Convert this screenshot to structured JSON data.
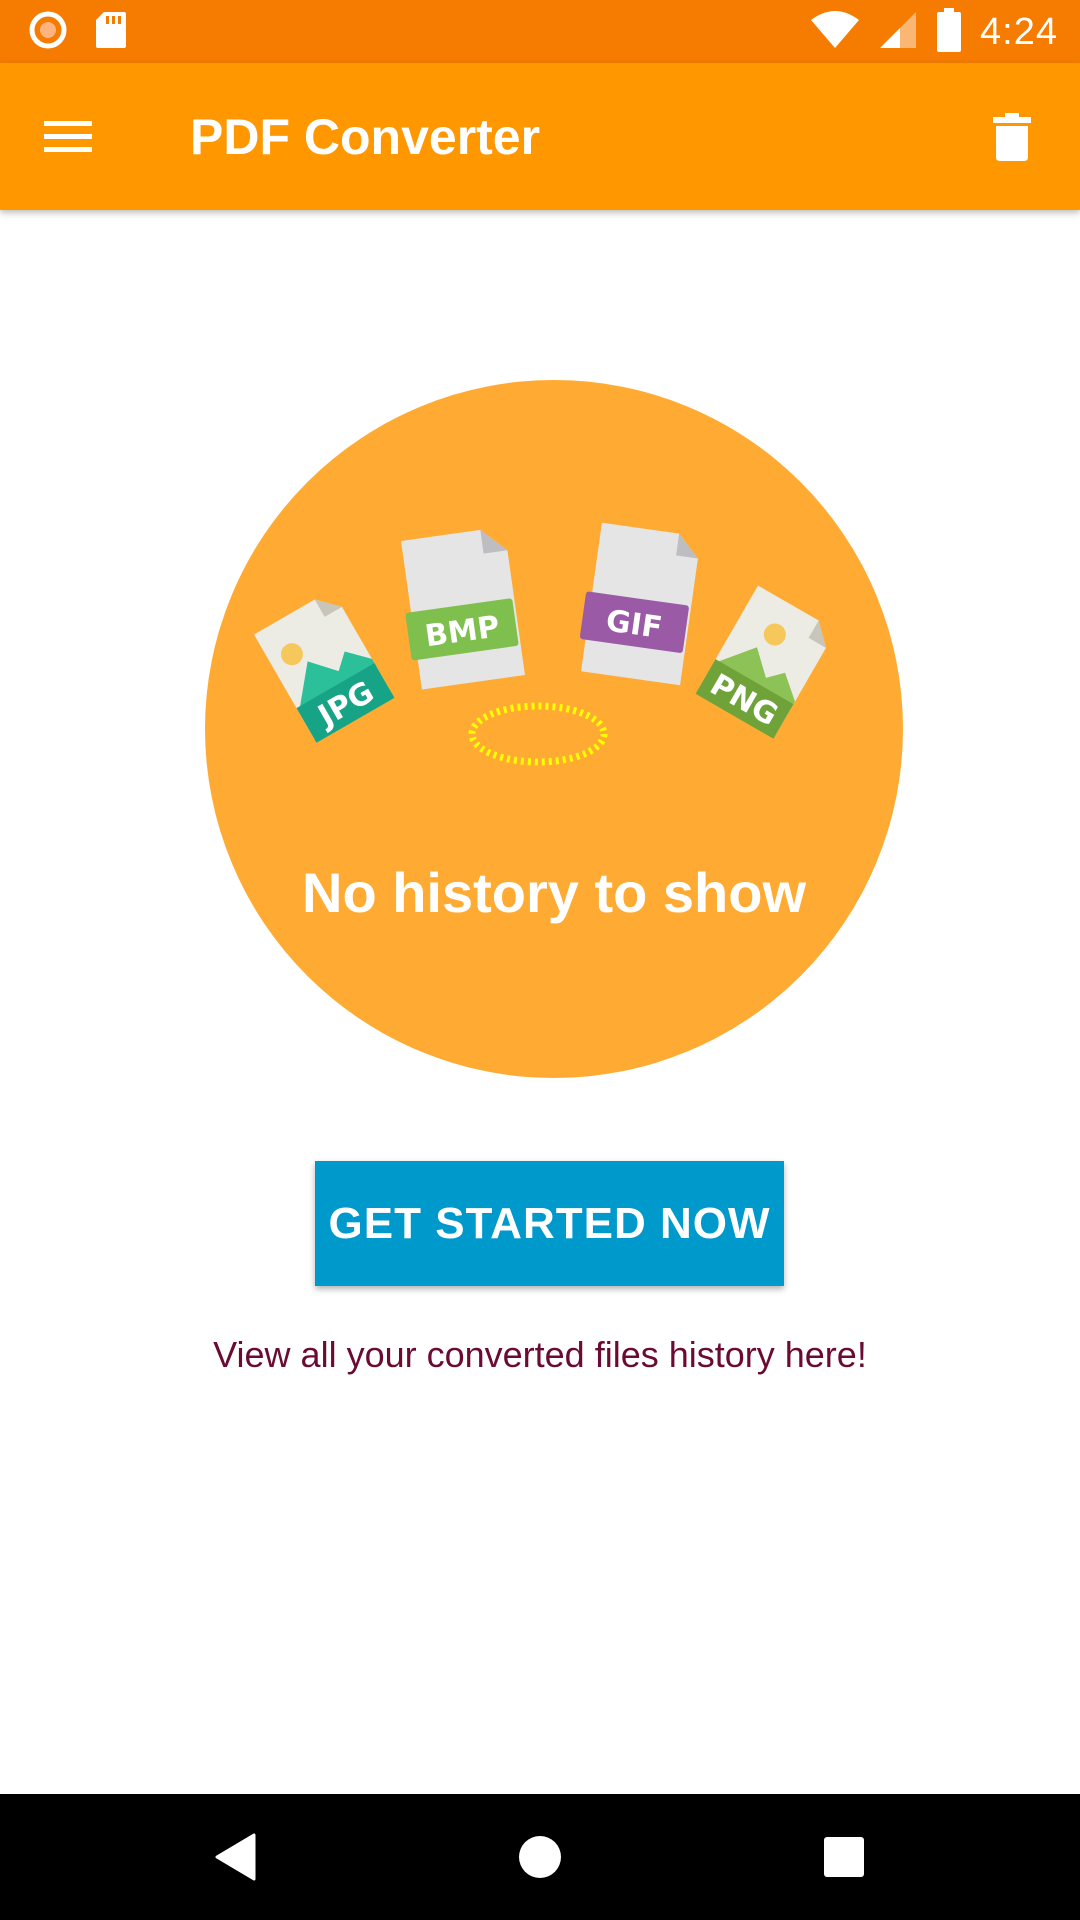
{
  "status_bar": {
    "time": "4:24",
    "color": "#f57c00",
    "icons": [
      "record-icon",
      "sd-card-icon",
      "wifi-icon",
      "cell-signal-icon",
      "battery-icon"
    ]
  },
  "app_bar": {
    "title": "PDF Converter",
    "color": "#ff9800",
    "menu_icon": "hamburger-menu-icon",
    "action_icon": "trash-icon"
  },
  "empty_state": {
    "title": "No history to show",
    "circle_color": "#ffab33",
    "file_types": [
      "JPG",
      "BMP",
      "GIF",
      "PNG"
    ],
    "button_label": "GET STARTED NOW",
    "button_color": "#0099cc",
    "hint": "View all your converted files history here!",
    "hint_color": "#6b0a33"
  },
  "nav_bar": {
    "icons": [
      "back-icon",
      "home-icon",
      "recents-icon"
    ]
  }
}
